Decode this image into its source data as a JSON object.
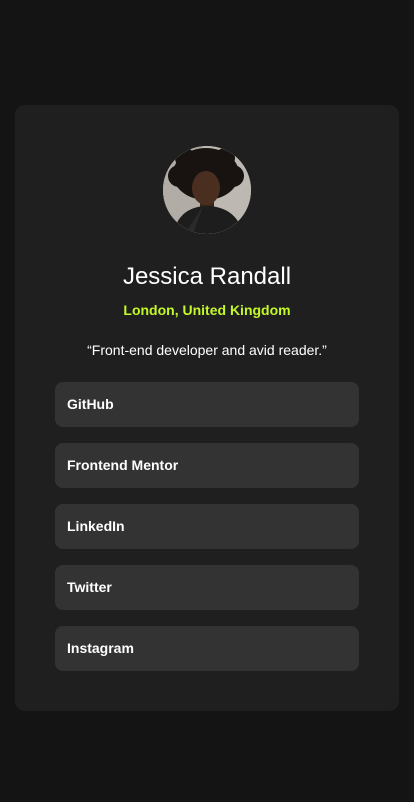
{
  "profile": {
    "name": "Jessica Randall",
    "location": "London, United Kingdom",
    "bio": "“Front-end developer and avid reader.”"
  },
  "links": [
    {
      "label": "GitHub"
    },
    {
      "label": "Frontend Mentor"
    },
    {
      "label": "LinkedIn"
    },
    {
      "label": "Twitter"
    },
    {
      "label": "Instagram"
    }
  ],
  "colors": {
    "page_background": "#141414",
    "card_background": "#1f1f1f",
    "link_background": "#333333",
    "accent": "#c4f82a",
    "text": "#ffffff"
  }
}
